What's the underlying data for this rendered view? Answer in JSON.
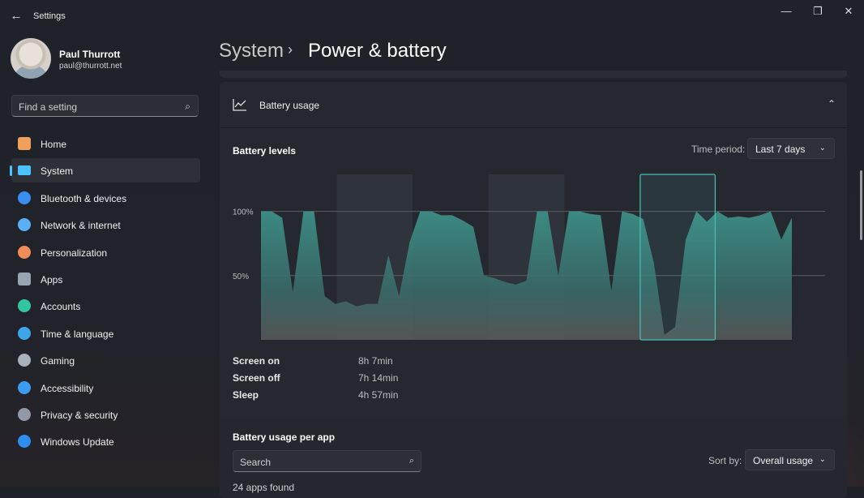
{
  "window": {
    "title": "Settings",
    "controls": {
      "minimize": "—",
      "maximize": "❐",
      "close": "✕"
    }
  },
  "user": {
    "name": "Paul Thurrott",
    "email": "paul@thurrott.net"
  },
  "search": {
    "placeholder": "Find a setting"
  },
  "nav": [
    {
      "label": "Home",
      "icon": "home-icon",
      "color": "#f0a05a"
    },
    {
      "label": "System",
      "icon": "system-icon",
      "color": "#4cc2ff",
      "selected": true
    },
    {
      "label": "Bluetooth & devices",
      "icon": "bluetooth-icon",
      "color": "#3b8ef0"
    },
    {
      "label": "Network & internet",
      "icon": "network-icon",
      "color": "#59b0f5"
    },
    {
      "label": "Personalization",
      "icon": "brush-icon",
      "color": "#f08c5a"
    },
    {
      "label": "Apps",
      "icon": "apps-icon",
      "color": "#9aa5b4"
    },
    {
      "label": "Accounts",
      "icon": "accounts-icon",
      "color": "#2fc6a0"
    },
    {
      "label": "Time & language",
      "icon": "globe-clock-icon",
      "color": "#3ea6e8"
    },
    {
      "label": "Gaming",
      "icon": "gaming-icon",
      "color": "#a7b0bb"
    },
    {
      "label": "Accessibility",
      "icon": "accessibility-icon",
      "color": "#3b9cf0"
    },
    {
      "label": "Privacy & security",
      "icon": "shield-icon",
      "color": "#8f9aa6"
    },
    {
      "label": "Windows Update",
      "icon": "update-icon",
      "color": "#2f8df0"
    }
  ],
  "breadcrumb": {
    "parent": "System",
    "separator": "›",
    "current": "Power & battery"
  },
  "battery_usage": {
    "header": "Battery usage",
    "levels_title": "Battery levels",
    "time_period_label": "Time period:",
    "time_period_value": "Last 7 days",
    "stats": [
      {
        "label": "Screen on",
        "value": "8h 7min"
      },
      {
        "label": "Screen off",
        "value": "7h 14min"
      },
      {
        "label": "Sleep",
        "value": "4h 57min"
      }
    ]
  },
  "per_app": {
    "title": "Battery usage per app",
    "search_placeholder": "Search",
    "sort_label": "Sort by:",
    "sort_value": "Overall usage",
    "apps_found": "24 apps found"
  },
  "chart_data": {
    "type": "area",
    "y_ticks": [
      "100%",
      "50%"
    ],
    "ylim": [
      0,
      125
    ],
    "x": [
      0,
      2,
      4,
      6,
      8,
      10,
      12,
      14,
      16,
      18,
      20,
      22,
      24,
      26,
      28,
      30,
      32,
      34,
      36,
      38,
      40,
      42,
      44,
      46,
      48,
      50,
      52,
      54,
      56,
      58,
      60,
      62,
      64,
      66,
      68,
      70,
      72,
      74,
      76,
      78,
      80,
      82,
      84,
      86,
      88,
      90,
      92,
      94,
      96,
      98,
      100
    ],
    "values": [
      100,
      100,
      95,
      37,
      100,
      100,
      34,
      28,
      30,
      26,
      28,
      28,
      66,
      34,
      76,
      100,
      100,
      97,
      97,
      93,
      88,
      50,
      48,
      45,
      43,
      46,
      100,
      100,
      50,
      100,
      100,
      98,
      97,
      38,
      100,
      98,
      94,
      60,
      4,
      10,
      78,
      100,
      92,
      100,
      95,
      96,
      95,
      97,
      100,
      78,
      95
    ],
    "shaded_days": 3,
    "highlighted_day": 6,
    "day_count": 7,
    "grid": true
  }
}
